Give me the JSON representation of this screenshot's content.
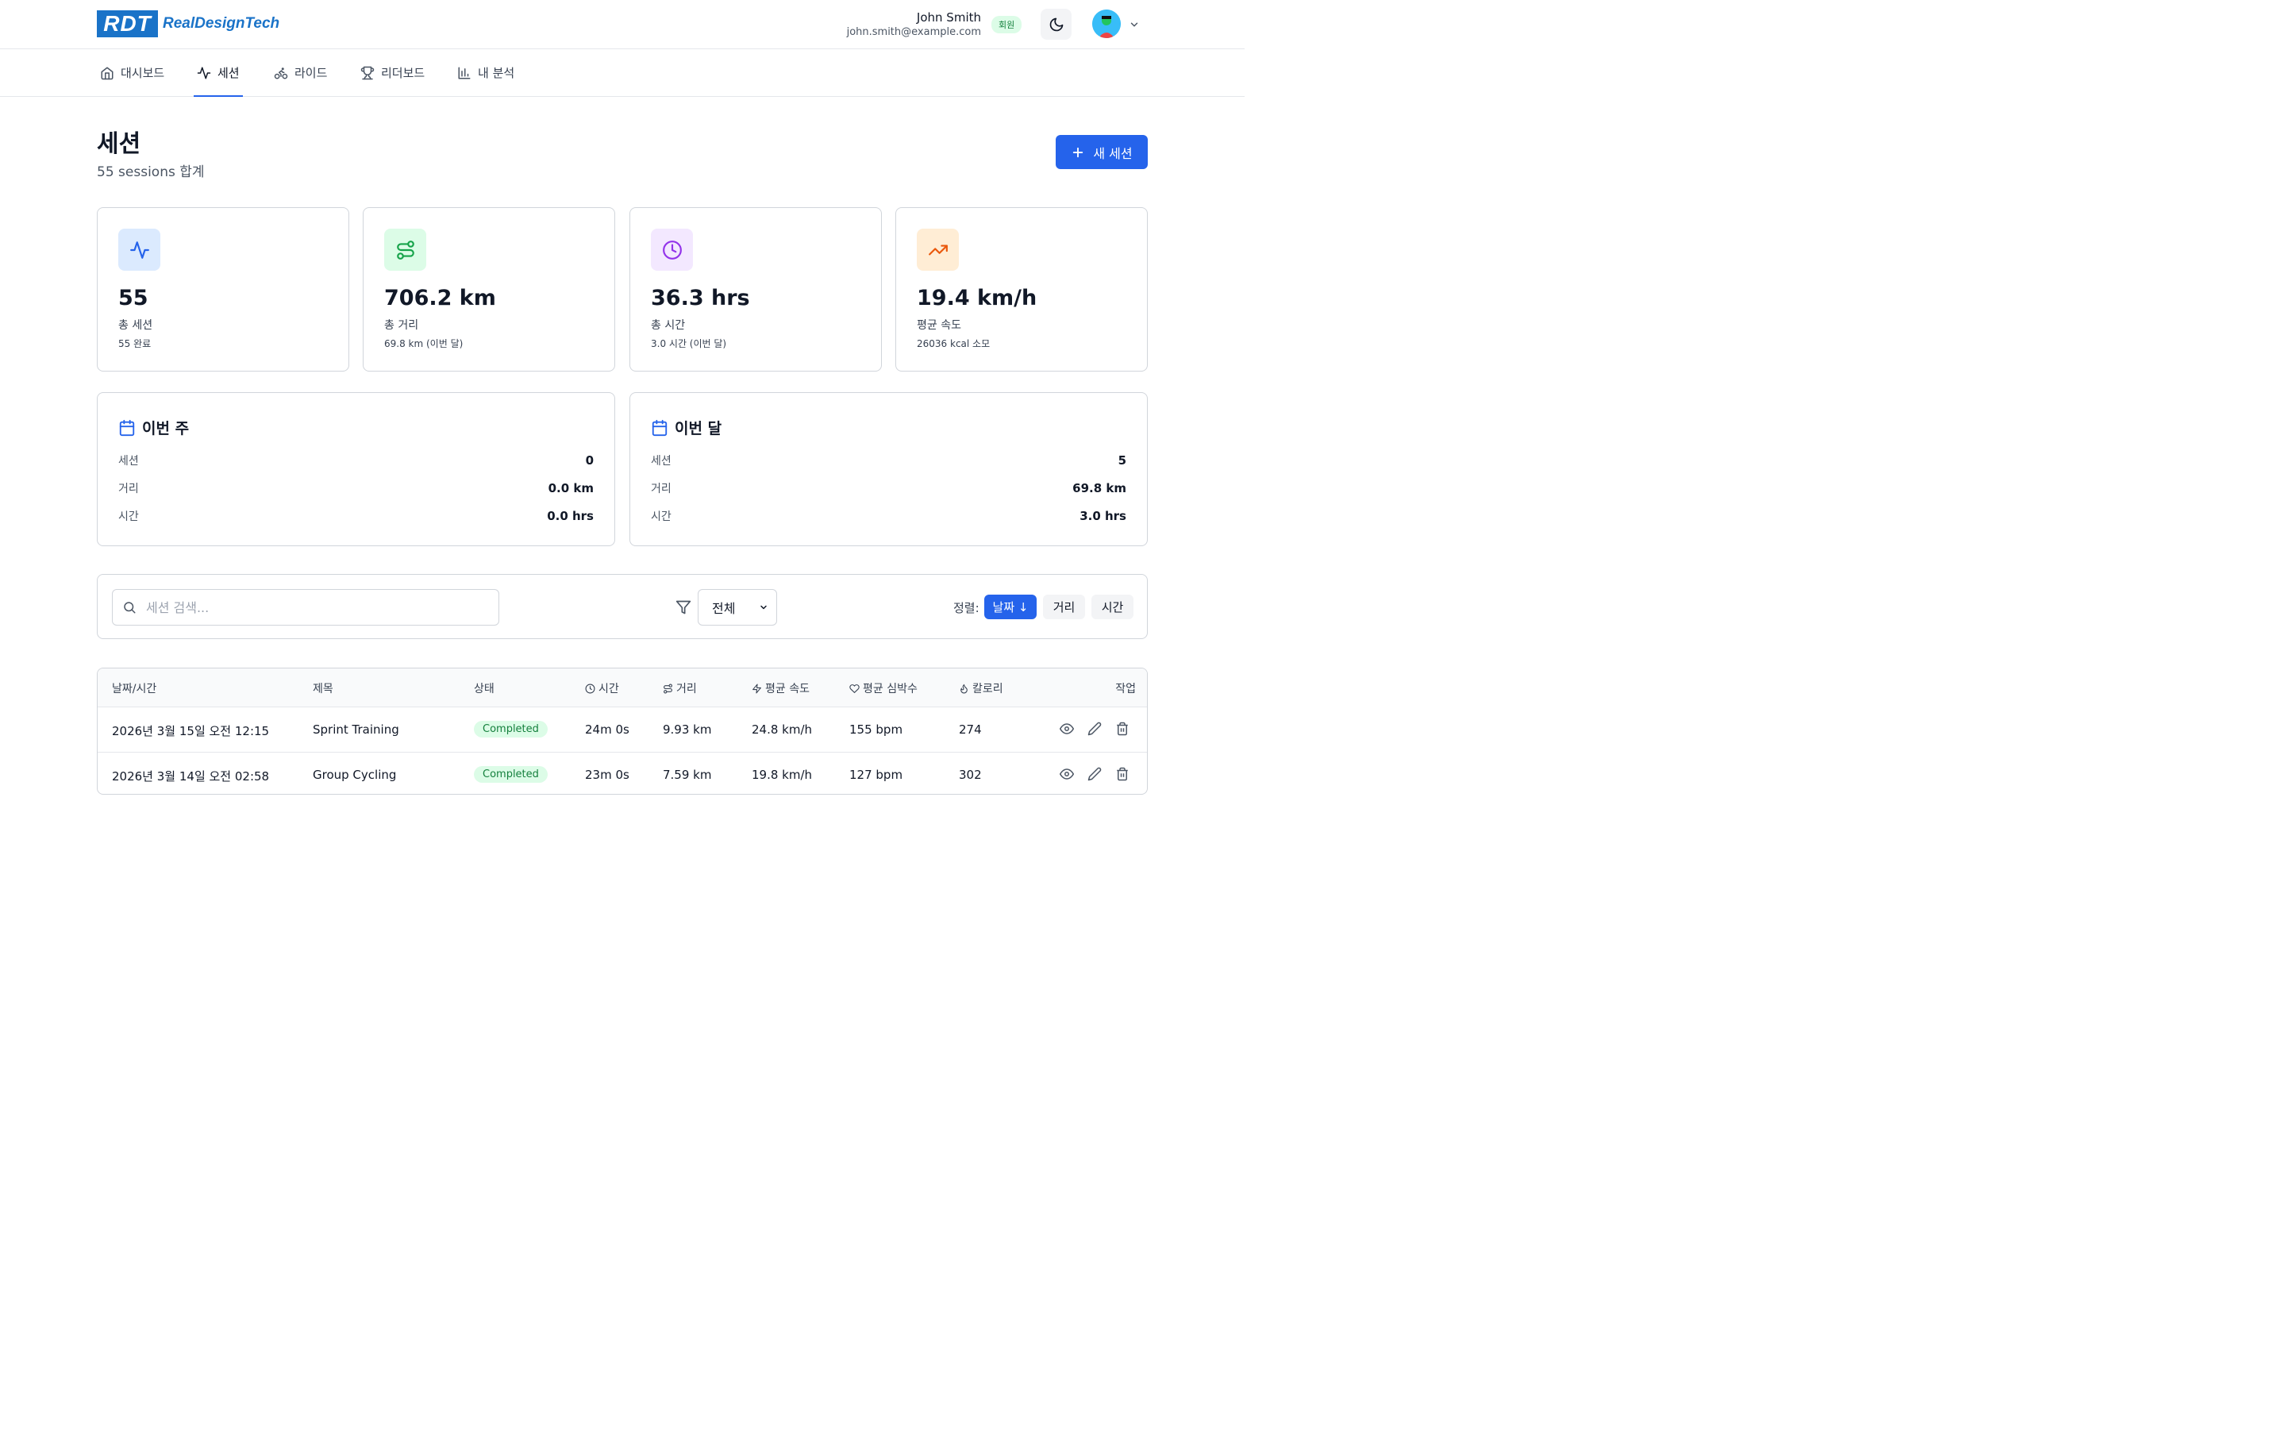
{
  "brand": {
    "logo_mark": "RDT",
    "logo_text": "RealDesignTech",
    "color": "#1a73c8"
  },
  "user": {
    "name": "John Smith",
    "email": "john.smith@example.com",
    "badge": "회원"
  },
  "nav": {
    "items": [
      {
        "label": "대시보드",
        "icon": "home-icon"
      },
      {
        "label": "세션",
        "icon": "activity-icon",
        "active": true
      },
      {
        "label": "라이드",
        "icon": "bike-icon"
      },
      {
        "label": "리더보드",
        "icon": "trophy-icon"
      },
      {
        "label": "내 분석",
        "icon": "bar-chart-icon"
      }
    ]
  },
  "page": {
    "title": "세션",
    "subtitle": "55 sessions 합계",
    "new_button": "새 세션"
  },
  "stats": [
    {
      "value": "55",
      "label": "총 세션",
      "sub": "55 완료",
      "icon": "activity-icon",
      "bg": "#dbeafe",
      "color": "#2563eb"
    },
    {
      "value": "706.2 km",
      "label": "총 거리",
      "sub": "69.8 km (이번 달)",
      "icon": "route-icon",
      "bg": "#dcfce7",
      "color": "#16a34a"
    },
    {
      "value": "36.3 hrs",
      "label": "총 시간",
      "sub": "3.0 시간 (이번 달)",
      "icon": "clock-icon",
      "bg": "#f3e8ff",
      "color": "#9333ea"
    },
    {
      "value": "19.4 km/h",
      "label": "평균 속도",
      "sub": "26036 kcal 소모",
      "icon": "trending-up-icon",
      "bg": "#ffedd5",
      "color": "#ea580c"
    }
  ],
  "week": {
    "title": "이번 주",
    "rows": [
      {
        "key": "세션",
        "value": "0"
      },
      {
        "key": "거리",
        "value": "0.0 km"
      },
      {
        "key": "시간",
        "value": "0.0 hrs"
      }
    ]
  },
  "month": {
    "title": "이번 달",
    "rows": [
      {
        "key": "세션",
        "value": "5"
      },
      {
        "key": "거리",
        "value": "69.8 km"
      },
      {
        "key": "시간",
        "value": "3.0 hrs"
      }
    ]
  },
  "filters": {
    "search_placeholder": "세션 검색...",
    "select_value": "전체",
    "sort_label": "정렬:",
    "sort_options": [
      "날짜 ↓",
      "거리",
      "시간"
    ]
  },
  "table": {
    "headers": [
      "날짜/시간",
      "제목",
      "상태",
      "시간",
      "거리",
      "평균 속도",
      "평균 심박수",
      "칼로리",
      "작업"
    ],
    "rows": [
      {
        "date": "2026년 3월 15일 오전 12:15",
        "title": "Sprint Training",
        "status": "Completed",
        "time": "24m 0s",
        "distance": "9.93 km",
        "speed": "24.8 km/h",
        "hr": "155 bpm",
        "cal": "274"
      },
      {
        "date": "2026년 3월 14일 오전 02:58",
        "title": "Group Cycling",
        "status": "Completed",
        "time": "23m 0s",
        "distance": "7.59 km",
        "speed": "19.8 km/h",
        "hr": "127 bpm",
        "cal": "302"
      }
    ]
  }
}
